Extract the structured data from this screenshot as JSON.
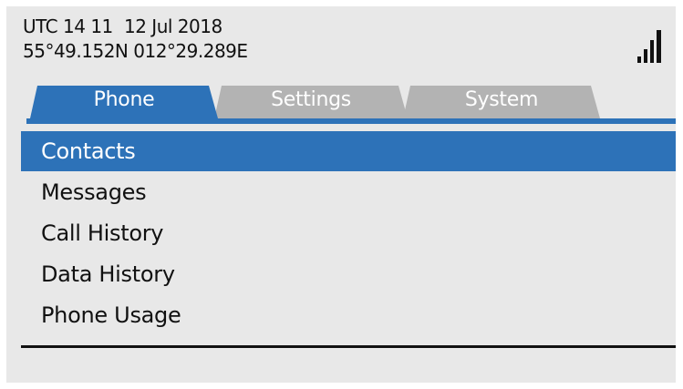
{
  "status": {
    "time": "UTC 14 11",
    "date": "12 Jul 2018",
    "position": "55°49.152N  012°29.289E",
    "signal_bars": 4
  },
  "tabs": [
    {
      "label": "Phone",
      "active": true
    },
    {
      "label": "Settings",
      "active": false
    },
    {
      "label": "System",
      "active": false
    }
  ],
  "menu": {
    "items": [
      {
        "label": "Contacts",
        "selected": true
      },
      {
        "label": "Messages",
        "selected": false
      },
      {
        "label": "Call History",
        "selected": false
      },
      {
        "label": "Data History",
        "selected": false
      },
      {
        "label": "Phone Usage",
        "selected": false
      }
    ]
  },
  "colors": {
    "accent": "#2d72b8",
    "inactive_tab": "#b3b3b3",
    "background": "#e8e8e8",
    "text": "#111111"
  }
}
